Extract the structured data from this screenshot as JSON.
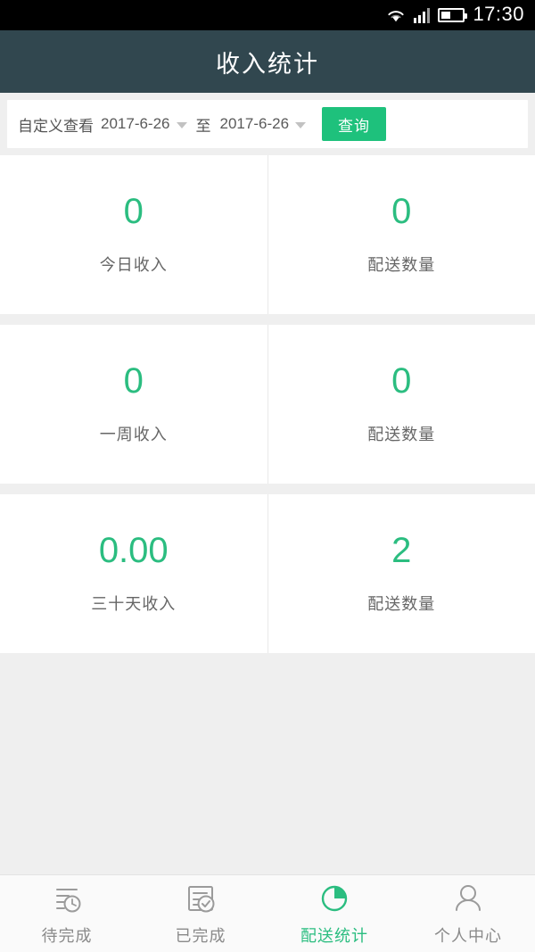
{
  "statusbar": {
    "time": "17:30",
    "icons": [
      "wifi-icon",
      "signal-icon",
      "battery-icon"
    ]
  },
  "header": {
    "title": "收入统计",
    "bg_color": "#31474f"
  },
  "filter": {
    "label": "自定义查看",
    "start_date": "2017-6-26",
    "to_label": "至",
    "end_date": "2017-6-26",
    "query_label": "查询",
    "accent_color": "#1ec17c"
  },
  "stats": {
    "value_color": "#2bbd80",
    "rows": [
      {
        "left": {
          "value": "0",
          "label": "今日收入"
        },
        "right": {
          "value": "0",
          "label": "配送数量"
        }
      },
      {
        "left": {
          "value": "0",
          "label": "一周收入"
        },
        "right": {
          "value": "0",
          "label": "配送数量"
        }
      },
      {
        "left": {
          "value": "0.00",
          "label": "三十天收入"
        },
        "right": {
          "value": "2",
          "label": "配送数量"
        }
      }
    ]
  },
  "tabbar": {
    "active_index": 2,
    "active_color": "#2bbd80",
    "inactive_color": "#8a8a8a",
    "items": [
      {
        "label": "待完成",
        "icon": "pending-list-clock-icon"
      },
      {
        "label": "已完成",
        "icon": "document-check-icon"
      },
      {
        "label": "配送统计",
        "icon": "pie-chart-icon"
      },
      {
        "label": "个人中心",
        "icon": "person-icon"
      }
    ]
  }
}
